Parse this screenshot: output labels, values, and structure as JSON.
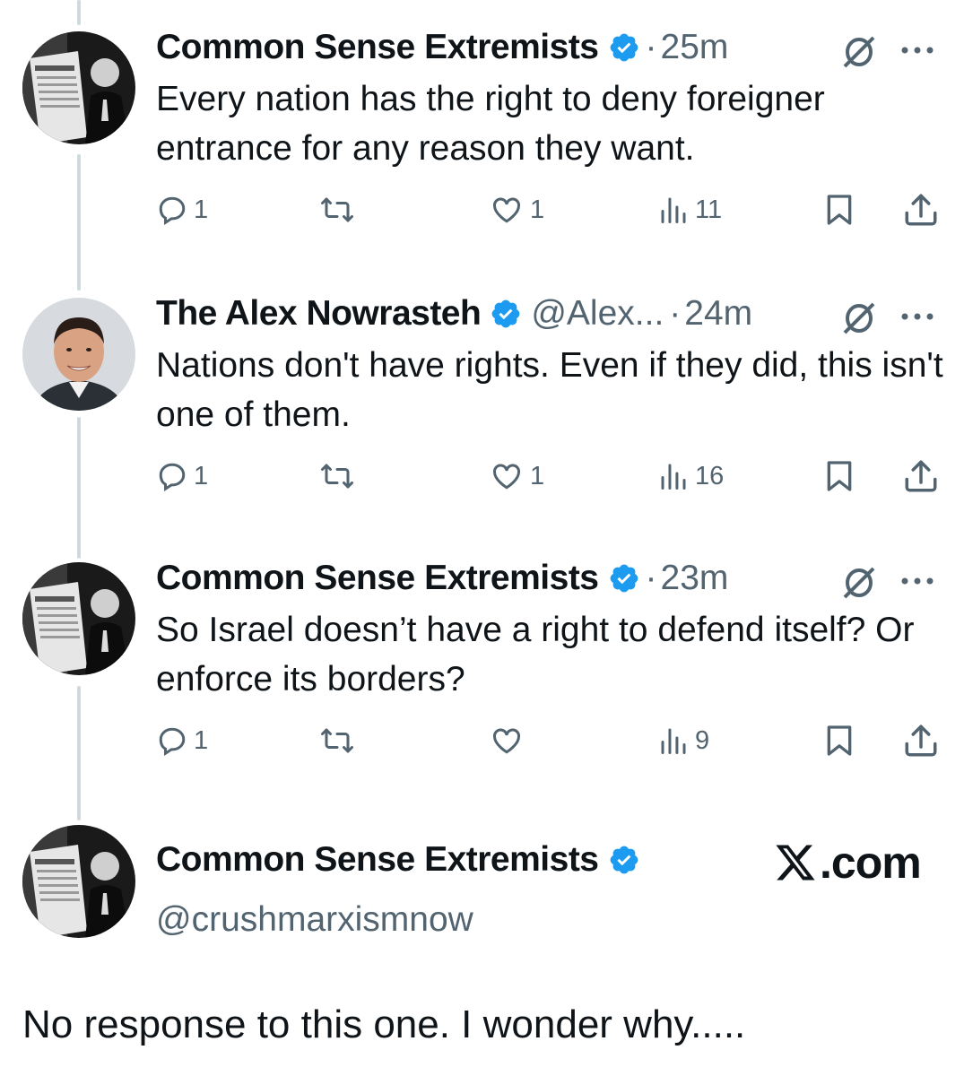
{
  "tweets": [
    {
      "name": "Common Sense Extremists",
      "handle": "",
      "dot": "·",
      "time": "25m",
      "text": "Every nation has the right to deny foreigner entrance for any reason they want.",
      "replies": "1",
      "reposts": "",
      "likes": "1",
      "views": "11",
      "avatar": "newspaper-photo-avatar"
    },
    {
      "name": "The Alex Nowrasteh",
      "handle": "@Alex...",
      "dot": "·",
      "time": "24m",
      "text": "Nations don't have rights. Even if they did, this isn't one of them.",
      "replies": "1",
      "reposts": "",
      "likes": "1",
      "views": "16",
      "avatar": "portrait-avatar"
    },
    {
      "name": "Common Sense Extremists",
      "handle": "",
      "dot": "·",
      "time": "23m",
      "text": "So Israel doesn’t have a right to defend itself? Or enforce its borders?",
      "replies": "1",
      "reposts": "",
      "likes": "",
      "views": "9",
      "avatar": "newspaper-photo-avatar"
    }
  ],
  "profile": {
    "name": "Common Sense Extremists",
    "handle": "@crushmarxismnow"
  },
  "watermark": ".com",
  "caption": "No response to this one. I wonder why.....",
  "colors": {
    "verified": "#1d9bf0",
    "secondary_text": "#536471",
    "thread_line": "#cfd9de"
  },
  "icons": [
    "reply-icon",
    "repost-icon",
    "like-icon",
    "views-icon",
    "bookmark-icon",
    "share-icon",
    "grok-icon",
    "more-icon",
    "verified-badge-icon",
    "x-logo-icon"
  ]
}
